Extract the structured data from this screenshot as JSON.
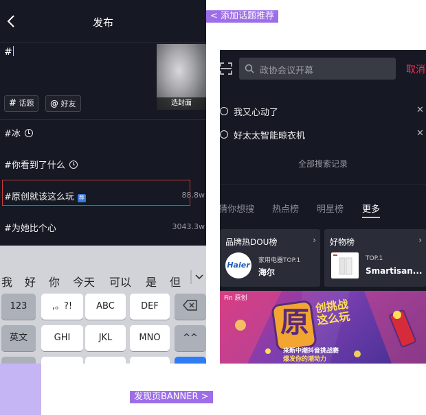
{
  "annotations": {
    "top": "< 添加话题推荐",
    "bottom": "发现页BANNER >"
  },
  "publish": {
    "title": "发布",
    "text": "#",
    "chips": [
      {
        "icon": "#",
        "label": "话题"
      },
      {
        "icon": "@",
        "label": "好友"
      }
    ],
    "cover_label": "选封面",
    "suggestions": [
      {
        "text": "#冰",
        "count": "",
        "recent": true,
        "new": false
      },
      {
        "text": "#你看到了什么",
        "count": "",
        "recent": true,
        "new": false
      },
      {
        "text": "#原创就该这么玩",
        "count": "88.8w",
        "recent": false,
        "new": true
      },
      {
        "text": "#为她比个心",
        "count": "3043.3w",
        "recent": false,
        "new": false
      }
    ],
    "new_badge": "荐"
  },
  "keyboard": {
    "candidates": [
      "我",
      "好",
      "你",
      "今天",
      "可以",
      "是",
      "但"
    ],
    "row1": [
      "123",
      ",。?!",
      "ABC",
      "DEF"
    ],
    "row2": [
      "英文",
      "GHI",
      "JKL",
      "MNO",
      "^^"
    ]
  },
  "discover": {
    "search_placeholder": "政协会议开幕",
    "cancel": "取消",
    "history": [
      "我又心动了",
      "好太太智能晾衣机"
    ],
    "all_history": "全部搜索记录",
    "tabs": [
      "猜你想搜",
      "热点榜",
      "明星榜",
      "更多"
    ],
    "active_tab": "更多",
    "cards": [
      {
        "title": "品牌热DOU榜",
        "logo": "Haier",
        "sub": "家用电器TOP.1",
        "name": "海尔"
      },
      {
        "title": "好物榜",
        "sub": "TOP.1",
        "name": "Smartisan..."
      }
    ],
    "banner": {
      "top_left": "Fin 原创",
      "big": "原",
      "slogan": "创挑战\n这么玩",
      "line1": "来新中潮抖音挑战赛",
      "line2": "爆发你的潮动力"
    }
  },
  "colors": {
    "dark_bg": "#161823",
    "accent_red": "#fe2c55",
    "annotation": "#9d6ee8",
    "tab_underline": "#f2c94c"
  }
}
